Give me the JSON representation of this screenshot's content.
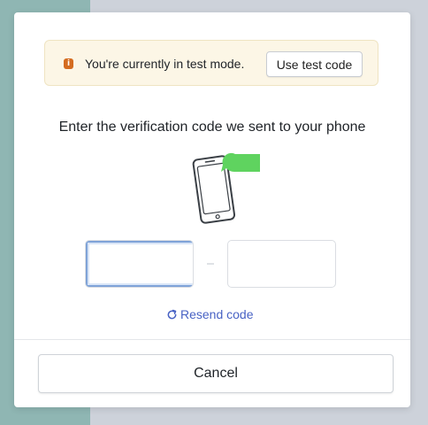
{
  "banner": {
    "icon": "info-icon",
    "text": "You're currently in test mode.",
    "button_label": "Use test code",
    "accent_color": "#d46b1f"
  },
  "heading": "Enter the verification code we sent to your phone",
  "illustration": {
    "icon": "phone-with-message-icon",
    "bubble_color": "#5fd35f"
  },
  "code": {
    "groups": [
      {
        "digits": [
          "",
          "",
          ""
        ]
      },
      {
        "digits": [
          "",
          "",
          ""
        ]
      }
    ],
    "separator": "-"
  },
  "resend": {
    "icon": "refresh-icon",
    "label": "Resend code",
    "color": "#4862c4"
  },
  "footer": {
    "cancel_label": "Cancel"
  }
}
